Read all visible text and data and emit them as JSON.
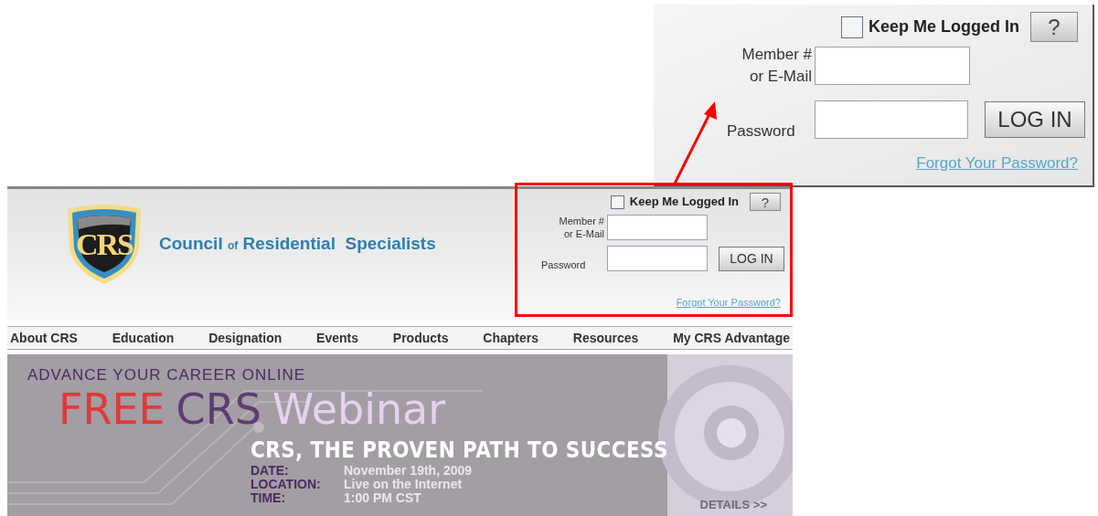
{
  "site": {
    "logo": {
      "badge": "CRS",
      "org_name": {
        "before": "Council",
        "small": "of",
        "after": "Residential  Specialists"
      }
    },
    "login": {
      "keep_logged_in": {
        "label": "Keep Me Logged In",
        "checked": false
      },
      "help": "?",
      "member_label": [
        "Member #",
        "or E-Mail"
      ],
      "password_label": "Password",
      "login_button": "LOG IN",
      "forgot_link": "Forgot Your Password?"
    },
    "nav": [
      "About CRS",
      "Education",
      "Designation",
      "Events",
      "Products",
      "Chapters",
      "Resources",
      "My CRS Advantage"
    ],
    "banner": {
      "kicker": "ADVANCE YOUR CAREER ONLINE",
      "title": [
        {
          "text": "FREE",
          "color": "#e0393a"
        },
        {
          "text": "CRS",
          "color": "#5e3b73"
        },
        {
          "text": "Webinar",
          "color": "#e6d2ef"
        }
      ],
      "tagline": "CRS, THE PROVEN PATH TO SUCCESS",
      "details": [
        {
          "label": "DATE:",
          "value": "November 19th, 2009"
        },
        {
          "label": "LOCATION:",
          "value": "Live on the Internet"
        },
        {
          "label": "TIME:",
          "value": "1:00 PM CST"
        }
      ],
      "details_link": "DETAILS >>"
    }
  },
  "zoom_callout": {
    "login": {
      "keep_logged_in": {
        "label": "Keep Me Logged In",
        "checked": false
      },
      "help": "?",
      "member_label": [
        "Member #",
        "or E-Mail"
      ],
      "password_label": "Password",
      "login_button": "LOG IN",
      "forgot_link": "Forgot Your Password?"
    }
  }
}
